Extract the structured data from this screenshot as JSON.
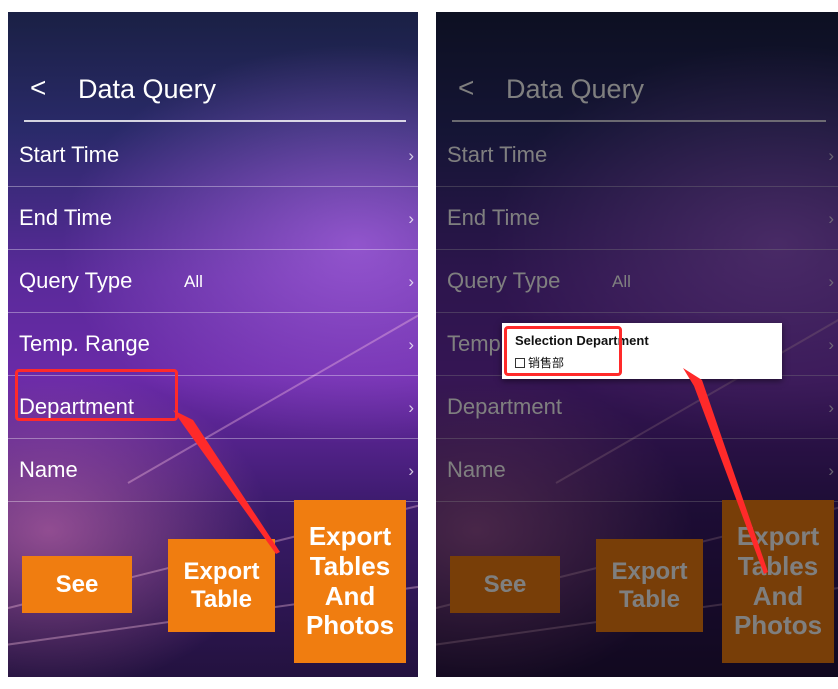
{
  "screen": {
    "back_icon": "chevron-left",
    "title": "Data Query",
    "menu": [
      {
        "label": "Start Time",
        "value": ""
      },
      {
        "label": "End Time",
        "value": ""
      },
      {
        "label": "Query Type",
        "value": "All"
      },
      {
        "label": "Temp. Range",
        "value": ""
      },
      {
        "label": "Department",
        "value": ""
      },
      {
        "label": "Name",
        "value": ""
      }
    ],
    "chevron": "›",
    "buttons": {
      "see": "See",
      "export_table": "Export Table",
      "export_tables_photos": "Export Tables And Photos"
    }
  },
  "dialog": {
    "title": "Selection Department",
    "options": [
      {
        "label": "销售部",
        "checked": false
      }
    ]
  },
  "colors": {
    "button": "#f07d10",
    "highlight": "#ff2a2a"
  }
}
